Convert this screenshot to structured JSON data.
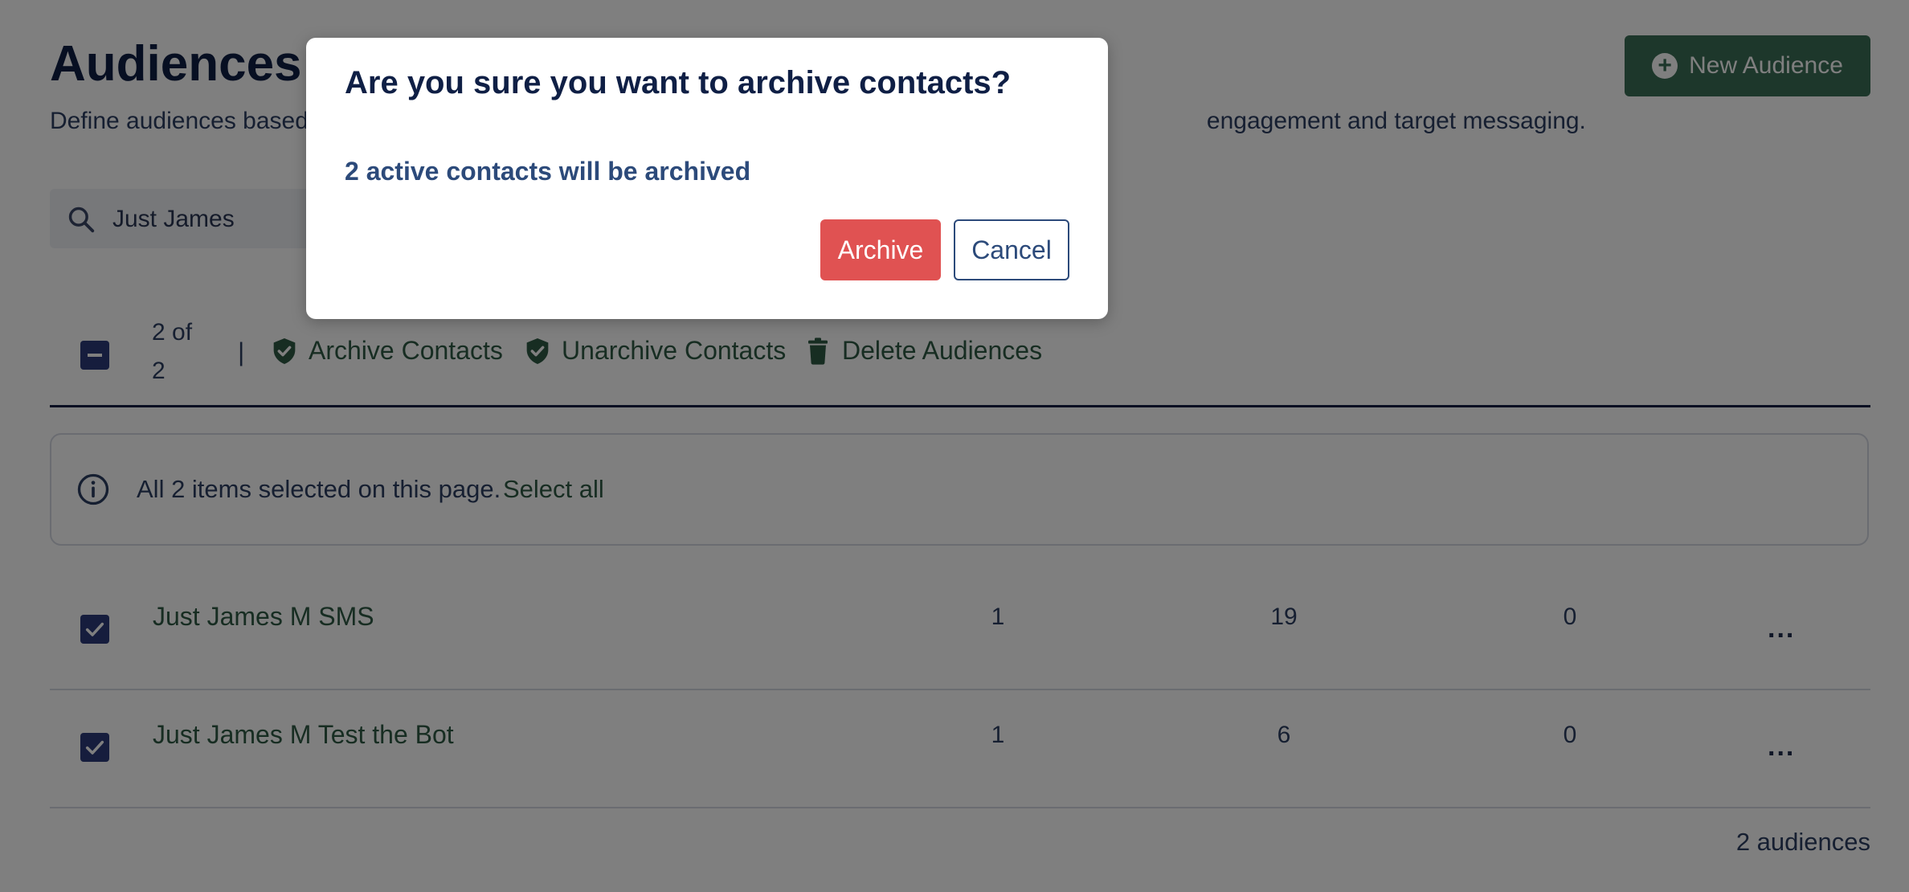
{
  "header": {
    "title": "Audiences",
    "subtitle_start": "Define audiences based",
    "subtitle_end": "engagement and target messaging.",
    "new_button_label": "New Audience"
  },
  "search": {
    "value": "Just James"
  },
  "toolbar": {
    "selected_count": "2 of 2",
    "separator": "|",
    "archive_label": "Archive Contacts",
    "unarchive_label": "Unarchive Contacts",
    "delete_label": "Delete Audiences"
  },
  "selection_banner": {
    "text": "All 2 items selected on this page.",
    "select_all_label": "Select all"
  },
  "rows": [
    {
      "name": "Just James M SMS",
      "col1": "1",
      "col2": "19",
      "col3": "0",
      "checked": true,
      "more": "..."
    },
    {
      "name": "Just James M Test the Bot",
      "col1": "1",
      "col2": "6",
      "col3": "0",
      "checked": true,
      "more": "..."
    }
  ],
  "footer": {
    "count": "2 audiences"
  },
  "modal": {
    "title": "Are you sure you want to archive contacts?",
    "body": "2 active contacts will be archived",
    "archive_label": "Archive",
    "cancel_label": "Cancel"
  },
  "colors": {
    "brand_green": "#3b6e56",
    "navy": "#0f1f45",
    "checkbox": "#2d3b7a",
    "danger": "#e05252"
  },
  "icons": {
    "new_button": "plus-circle-icon",
    "search": "search-icon",
    "archive": "shield-check-icon",
    "unarchive": "shield-check-icon",
    "delete": "trash-icon",
    "info": "info-icon",
    "row_more": "more-icon"
  }
}
